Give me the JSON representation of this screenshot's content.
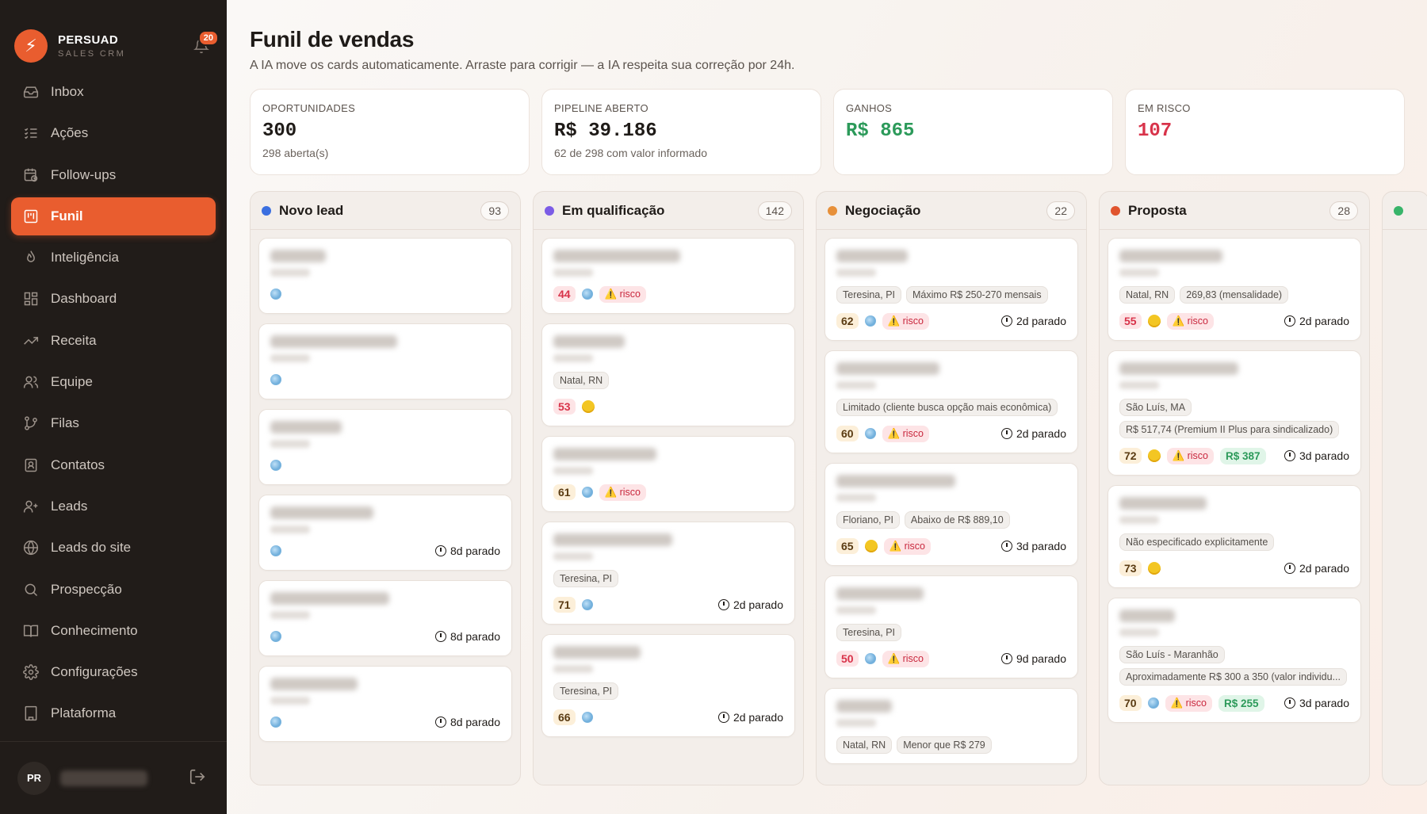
{
  "brand": {
    "name": "PERSUAD",
    "subtitle": "SALES CRM",
    "notifications": "20"
  },
  "nav": [
    {
      "label": "Inbox",
      "icon": "inbox-icon"
    },
    {
      "label": "Ações",
      "icon": "checklist-icon"
    },
    {
      "label": "Follow-ups",
      "icon": "calendar-clock-icon"
    },
    {
      "label": "Funil",
      "icon": "kanban-icon",
      "active": true
    },
    {
      "label": "Inteligência",
      "icon": "flame-icon"
    },
    {
      "label": "Dashboard",
      "icon": "grid-icon"
    },
    {
      "label": "Receita",
      "icon": "trend-up-icon"
    },
    {
      "label": "Equipe",
      "icon": "users-icon"
    },
    {
      "label": "Filas",
      "icon": "branch-icon"
    },
    {
      "label": "Contatos",
      "icon": "contact-icon"
    },
    {
      "label": "Leads",
      "icon": "user-plus-icon"
    },
    {
      "label": "Leads do site",
      "icon": "globe-icon"
    },
    {
      "label": "Prospecção",
      "icon": "search-icon"
    },
    {
      "label": "Conhecimento",
      "icon": "book-icon"
    },
    {
      "label": "Configurações",
      "icon": "gear-icon"
    },
    {
      "label": "Plataforma",
      "icon": "building-icon"
    }
  ],
  "user": {
    "initials": "PR"
  },
  "page": {
    "title": "Funil de vendas",
    "subtitle": "A IA move os cards automaticamente. Arraste para corrigir — a IA respeita sua correção por 24h."
  },
  "stats": [
    {
      "label": "OPORTUNIDADES",
      "value": "300",
      "sub": "298 aberta(s)",
      "tone": ""
    },
    {
      "label": "PIPELINE ABERTO",
      "value": "R$ 39.186",
      "sub": "62 de 298 com valor informado",
      "tone": ""
    },
    {
      "label": "GANHOS",
      "value": "R$ 865",
      "sub": "",
      "tone": "green"
    },
    {
      "label": "EM RISCO",
      "value": "107",
      "sub": "",
      "tone": "red"
    }
  ],
  "colors": {
    "accent": "#e95d2f",
    "blue": "#3b6fe0",
    "purple": "#7c5ce6",
    "orange": "#e7903a",
    "red": "#e0542e",
    "green": "#38b46a"
  },
  "columns": [
    {
      "title": "Novo lead",
      "count": "93",
      "dot": "#3b6fe0",
      "cards": [
        {
          "tags": [],
          "score": "",
          "sent": "globe",
          "risk": false,
          "money": "",
          "idle": ""
        },
        {
          "tags": [],
          "score": "",
          "sent": "globe",
          "risk": false,
          "money": "",
          "idle": ""
        },
        {
          "tags": [],
          "score": "",
          "sent": "globe",
          "risk": false,
          "money": "",
          "idle": ""
        },
        {
          "tags": [],
          "score": "",
          "sent": "globe",
          "risk": false,
          "money": "",
          "idle": "8d parado"
        },
        {
          "tags": [],
          "score": "",
          "sent": "globe",
          "risk": false,
          "money": "",
          "idle": "8d parado"
        },
        {
          "tags": [],
          "score": "",
          "sent": "globe",
          "risk": false,
          "money": "",
          "idle": "8d parado"
        }
      ]
    },
    {
      "title": "Em qualificação",
      "count": "142",
      "dot": "#7c5ce6",
      "cards": [
        {
          "tags": [],
          "score": "44",
          "tone": "red",
          "sent": "globe",
          "risk": true,
          "money": "",
          "idle": ""
        },
        {
          "tags": [
            "Natal, RN"
          ],
          "score": "53",
          "tone": "red",
          "sent": "sun",
          "risk": false,
          "money": "",
          "idle": ""
        },
        {
          "tags": [],
          "score": "61",
          "tone": "amber",
          "sent": "globe",
          "risk": true,
          "money": "",
          "idle": ""
        },
        {
          "tags": [
            "Teresina, PI"
          ],
          "score": "71",
          "tone": "amber",
          "sent": "globe",
          "risk": false,
          "money": "",
          "idle": "2d parado"
        },
        {
          "tags": [
            "Teresina, PI"
          ],
          "score": "66",
          "tone": "amber",
          "sent": "globe",
          "risk": false,
          "money": "",
          "idle": "2d parado"
        }
      ]
    },
    {
      "title": "Negociação",
      "count": "22",
      "dot": "#e7903a",
      "cards": [
        {
          "tags": [
            "Teresina, PI",
            "Máximo R$ 250-270 mensais"
          ],
          "score": "62",
          "tone": "amber",
          "sent": "globe",
          "risk": true,
          "money": "",
          "idle": "2d parado"
        },
        {
          "tags": [
            "Limitado (cliente busca opção mais econômica)"
          ],
          "score": "60",
          "tone": "amber",
          "sent": "globe",
          "risk": true,
          "money": "",
          "idle": "2d parado"
        },
        {
          "tags": [
            "Floriano, PI",
            "Abaixo de R$ 889,10"
          ],
          "score": "65",
          "tone": "amber",
          "sent": "sun",
          "risk": true,
          "money": "",
          "idle": "3d parado"
        },
        {
          "tags": [
            "Teresina, PI"
          ],
          "score": "50",
          "tone": "red",
          "sent": "globe",
          "risk": true,
          "money": "",
          "idle": "9d parado"
        },
        {
          "tags": [
            "Natal, RN",
            "Menor que R$ 279"
          ],
          "score": "",
          "sent": "",
          "risk": false,
          "money": "",
          "idle": ""
        }
      ]
    },
    {
      "title": "Proposta",
      "count": "28",
      "dot": "#e0542e",
      "cards": [
        {
          "tags": [
            "Natal, RN",
            "269,83 (mensalidade)"
          ],
          "score": "55",
          "tone": "red",
          "sent": "sun",
          "risk": true,
          "money": "",
          "idle": "2d parado"
        },
        {
          "tags": [
            "São Luís, MA",
            "R$ 517,74 (Premium II Plus para sindicalizado)"
          ],
          "score": "72",
          "tone": "amber",
          "sent": "sun",
          "risk": true,
          "money": "R$ 387",
          "idle": "3d parado"
        },
        {
          "tags": [
            "Não especificado explicitamente"
          ],
          "score": "73",
          "tone": "amber",
          "sent": "sun",
          "risk": false,
          "money": "",
          "idle": "2d parado"
        },
        {
          "tags": [
            "São Luís - Maranhão",
            "Aproximadamente R$ 300 a 350 (valor individu..."
          ],
          "score": "70",
          "tone": "amber",
          "sent": "globe",
          "risk": true,
          "money": "R$ 255",
          "idle": "3d parado"
        }
      ]
    }
  ],
  "risk_label": "⚠️ risco"
}
